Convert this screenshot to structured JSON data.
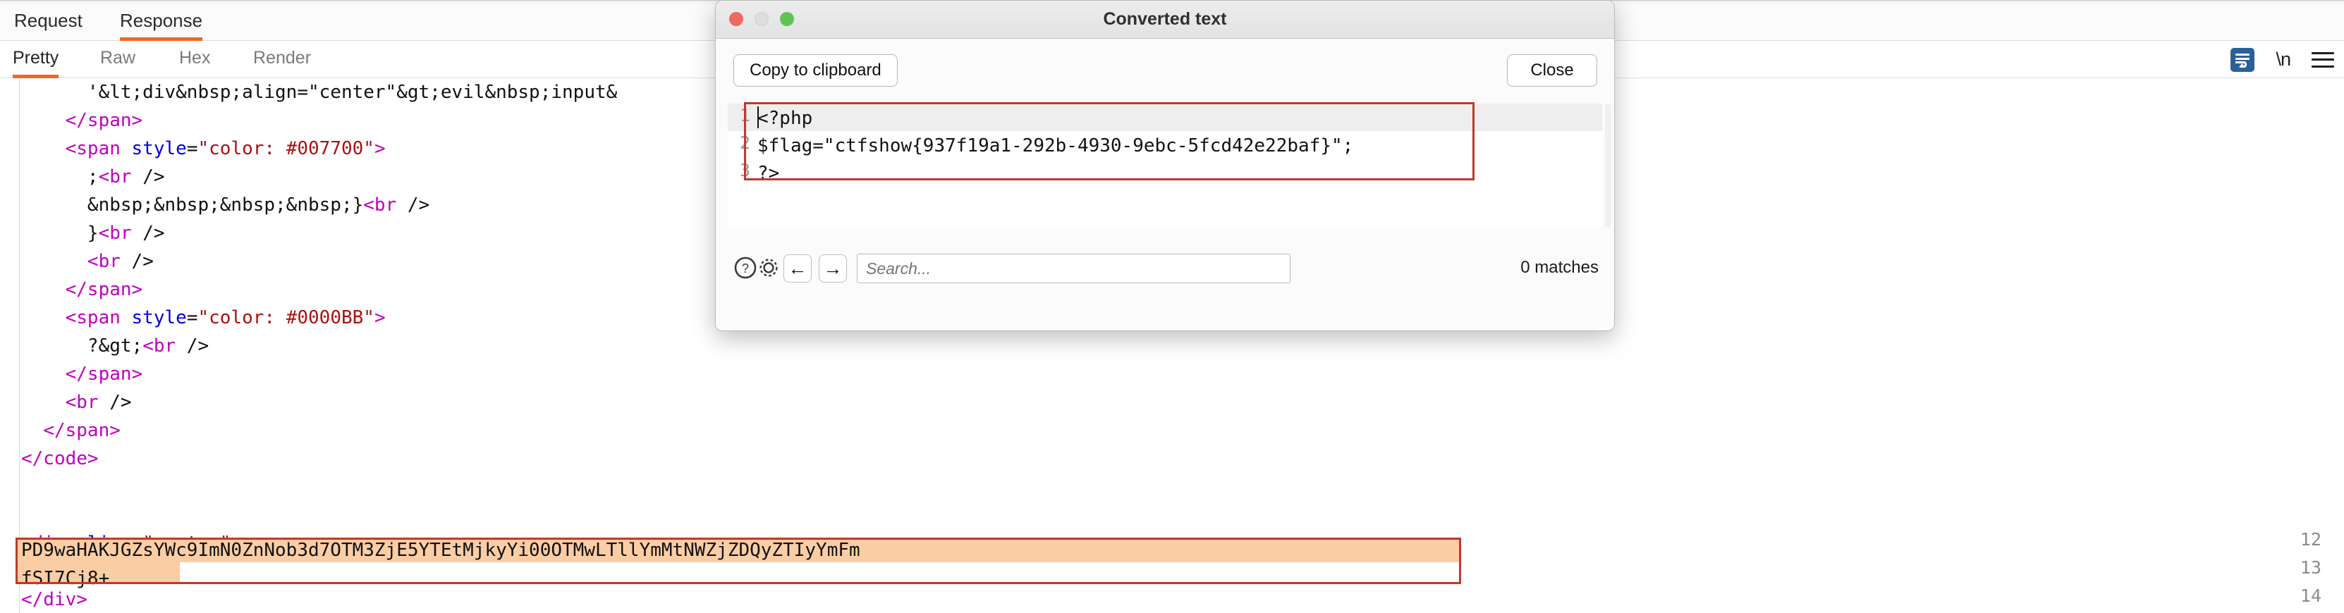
{
  "top_tabs": {
    "items": [
      {
        "id": "request",
        "label": "Request",
        "active": false
      },
      {
        "id": "response",
        "label": "Response",
        "active": true
      }
    ]
  },
  "sub_tabs": {
    "items": [
      {
        "id": "pretty",
        "label": "Pretty",
        "active": true
      },
      {
        "id": "raw",
        "label": "Raw",
        "active": false
      },
      {
        "id": "hex",
        "label": "Hex",
        "active": false
      },
      {
        "id": "render",
        "label": "Render",
        "active": false
      }
    ],
    "icons": [
      {
        "id": "word-wrap",
        "name": "word-wrap-icon",
        "active": true
      },
      {
        "id": "newline",
        "name": "newline-icon",
        "label": "\\n"
      },
      {
        "id": "menu",
        "name": "hamburger-menu-icon"
      }
    ]
  },
  "editor": {
    "accent_color": "#f26522",
    "highlight_fill": "#fbcda4",
    "highlight_border": "#c0392b",
    "syntax_colors": {
      "tag": "#c000c0",
      "attribute": "#0000dd",
      "value": "#aa1111",
      "text": "#111111"
    },
    "line_numbers": [
      "12",
      "13",
      "14"
    ],
    "lines": [
      {
        "segments": [
          {
            "t": "plain",
            "s": "      '&lt;div&nbsp;align=\"center\"&gt;evil&nbsp;input&"
          }
        ]
      },
      {
        "segments": [
          {
            "t": "plain",
            "s": "    "
          },
          {
            "t": "tag",
            "s": "</span>"
          }
        ]
      },
      {
        "segments": [
          {
            "t": "plain",
            "s": "    "
          },
          {
            "t": "tag",
            "s": "<span "
          },
          {
            "t": "attr",
            "s": "style"
          },
          {
            "t": "plain",
            "s": "="
          },
          {
            "t": "val",
            "s": "\"color: #007700\""
          },
          {
            "t": "tag",
            "s": ">"
          }
        ]
      },
      {
        "segments": [
          {
            "t": "plain",
            "s": "      ;"
          },
          {
            "t": "tag",
            "s": "<br"
          },
          {
            "t": "plain",
            "s": " />"
          }
        ]
      },
      {
        "segments": [
          {
            "t": "plain",
            "s": "      &nbsp;&nbsp;&nbsp;&nbsp;}"
          },
          {
            "t": "tag",
            "s": "<br"
          },
          {
            "t": "plain",
            "s": " />"
          }
        ]
      },
      {
        "segments": [
          {
            "t": "plain",
            "s": "      }"
          },
          {
            "t": "tag",
            "s": "<br"
          },
          {
            "t": "plain",
            "s": " />"
          }
        ]
      },
      {
        "segments": [
          {
            "t": "plain",
            "s": "      "
          },
          {
            "t": "tag",
            "s": "<br"
          },
          {
            "t": "plain",
            "s": " />"
          }
        ]
      },
      {
        "segments": [
          {
            "t": "plain",
            "s": "    "
          },
          {
            "t": "tag",
            "s": "</span>"
          }
        ]
      },
      {
        "segments": [
          {
            "t": "plain",
            "s": "    "
          },
          {
            "t": "tag",
            "s": "<span "
          },
          {
            "t": "attr",
            "s": "style"
          },
          {
            "t": "plain",
            "s": "="
          },
          {
            "t": "val",
            "s": "\"color: #0000BB\""
          },
          {
            "t": "tag",
            "s": ">"
          }
        ]
      },
      {
        "segments": [
          {
            "t": "plain",
            "s": "      ?&gt;"
          },
          {
            "t": "tag",
            "s": "<br"
          },
          {
            "t": "plain",
            "s": " />"
          }
        ]
      },
      {
        "segments": [
          {
            "t": "plain",
            "s": "    "
          },
          {
            "t": "tag",
            "s": "</span>"
          }
        ]
      },
      {
        "segments": [
          {
            "t": "plain",
            "s": "    "
          },
          {
            "t": "tag",
            "s": "<br"
          },
          {
            "t": "plain",
            "s": " />"
          }
        ]
      },
      {
        "segments": [
          {
            "t": "plain",
            "s": "  "
          },
          {
            "t": "tag",
            "s": "</span>"
          }
        ]
      },
      {
        "segments": [
          {
            "t": "tag",
            "s": "</code>"
          }
        ]
      },
      {
        "segments": [
          {
            "t": "plain",
            "s": ""
          }
        ]
      },
      {
        "segments": [
          {
            "t": "plain",
            "s": ""
          }
        ]
      },
      {
        "segments": [
          {
            "t": "tag",
            "s": "<div "
          },
          {
            "t": "attr",
            "s": "align"
          },
          {
            "t": "plain",
            "s": "="
          },
          {
            "t": "val",
            "s": "\"center\""
          },
          {
            "t": "tag",
            "s": ">"
          }
        ]
      },
      {
        "segments": [
          {
            "t": "plain",
            "s": "  fSI7Cj8+"
          }
        ]
      },
      {
        "segments": [
          {
            "t": "tag",
            "s": "</div>"
          }
        ]
      }
    ],
    "highlighted_selection": {
      "line1": "PD9waHAKJGZsYWc9ImN0ZnNob3d7OTM3ZjE5YTEtMjkyYi00OTMwLTllYmMtNWZjZDQyZTIyYmFm",
      "line2": "fSI7Cj8+"
    }
  },
  "modal": {
    "title": "Converted text",
    "traffic_lights": [
      {
        "name": "close",
        "color": "#ec6a5e"
      },
      {
        "name": "minimize",
        "color": "#dddddd"
      },
      {
        "name": "zoom",
        "color": "#5fc454"
      }
    ],
    "copy_label": "Copy to clipboard",
    "close_label": "Close",
    "code": {
      "line_numbers": [
        "1",
        "2",
        "3"
      ],
      "lines": [
        "<?php",
        "$flag=\"ctfshow{937f19a1-292b-4930-9ebc-5fcd42e22baf}\";",
        "?>"
      ]
    },
    "footer": {
      "help_icon": "?",
      "prev_arrow": "←",
      "next_arrow": "→",
      "search_placeholder": "Search...",
      "search_value": "",
      "matches_label": "0 matches"
    }
  }
}
